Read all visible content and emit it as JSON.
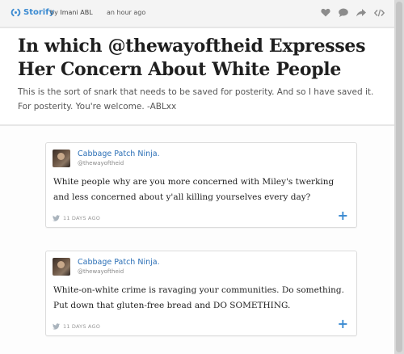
{
  "topbar": {
    "brand": "Storify",
    "by_prefix": "by",
    "author": "Imani ABL",
    "time": "an hour ago",
    "icons": [
      "heart-icon",
      "comment-icon",
      "share-icon",
      "embed-icon"
    ],
    "accent": "#3a8ad1"
  },
  "story": {
    "title": "In which @thewayoftheid Expresses Her Concern About White People",
    "description": "This is the sort of snark that needs to be saved for posterity. And so I have saved it. For posterity. You're welcome. -ABLxx"
  },
  "tweets": [
    {
      "name": "Cabbage Patch Ninja.",
      "handle": "@thewayoftheid",
      "text": "White people why are you more concerned with Miley's twerking and less concerned about y'all killing yourselves every day?",
      "time": "11 DAYS AGO",
      "add": "+"
    },
    {
      "name": "Cabbage Patch Ninja.",
      "handle": "@thewayoftheid",
      "text": "White-on-white crime is ravaging your communities. Do something. Put down that gluten-free bread and DO SOMETHING.",
      "time": "11 DAYS AGO",
      "add": "+"
    }
  ]
}
